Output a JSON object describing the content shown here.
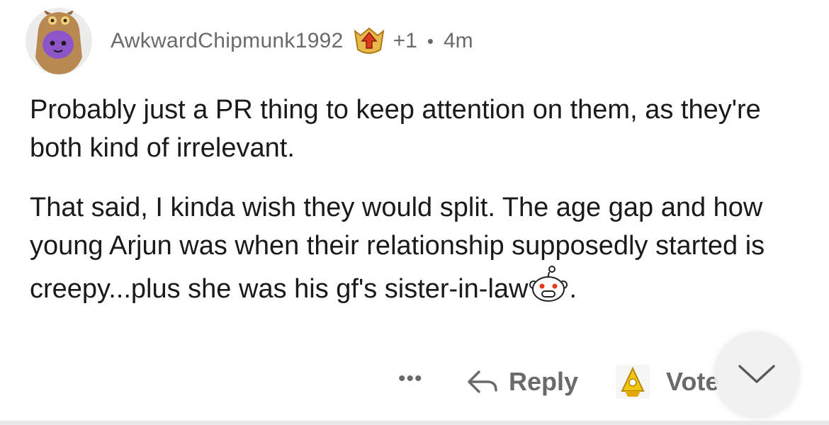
{
  "comment": {
    "author": "AwkwardChipmunk1992",
    "award_count": "+1",
    "separator": "•",
    "age": "4m",
    "paragraphs": [
      "Probably just a PR thing to keep attention on them, as they're both kind of irrelevant.",
      "That said, I kinda wish they would split. The age gap and how young Arjun was when their relationship supposedly started is creepy...plus she was his gf's sister-in-law"
    ],
    "paragraph_end": "."
  },
  "actions": {
    "more_label": "•••",
    "reply_label": "Reply",
    "vote_label": "Vote"
  },
  "icons": {
    "avatar": "owl-hood-avatar",
    "award": "upvote-award-icon",
    "emoji": "snoo-screaming-emoji",
    "reply": "reply-arrow-icon",
    "vote": "gold-upvote-award-icon",
    "collapse": "chevron-down-icon"
  },
  "colors": {
    "text": "#1a1a1b",
    "meta": "#6a6a6c",
    "award_red": "#d93a1e",
    "award_gold": "#f1c40f"
  }
}
